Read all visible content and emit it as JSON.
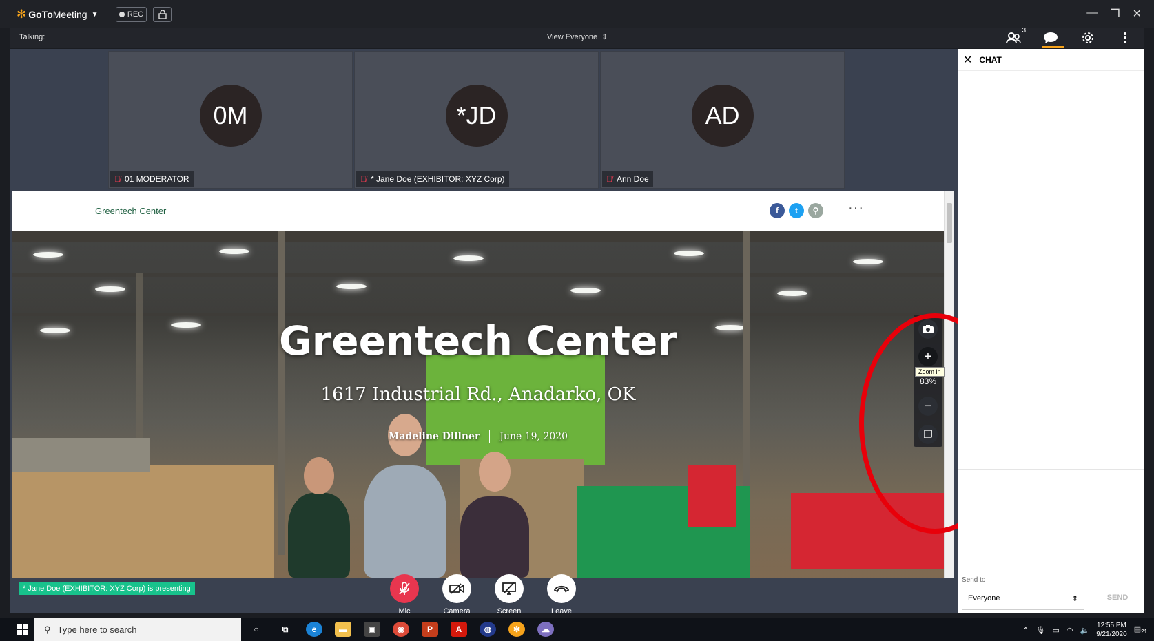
{
  "app": {
    "logo_bold": "GoTo",
    "logo_rest": "Meeting",
    "rec_label": "REC"
  },
  "meetbar": {
    "talking_label": "Talking:",
    "view_label": "View Everyone",
    "participants_count": "3"
  },
  "participants": [
    {
      "initials": "0M",
      "name": "01 MODERATOR"
    },
    {
      "initials": "*JD",
      "name": "* Jane Doe (EXHIBITOR: XYZ Corp)"
    },
    {
      "initials": "AD",
      "name": "Ann Doe"
    }
  ],
  "shared": {
    "brand": "Greentech Center",
    "more": "···",
    "title": "Greentech Center",
    "address": "1617 Industrial Rd., Anadarko, OK",
    "author": "Madeline Dillner",
    "date": "June 19, 2020"
  },
  "zoom": {
    "percent": "83%",
    "tooltip": "Zoom in"
  },
  "controls": {
    "presenting": "* Jane Doe (EXHIBITOR: XYZ Corp) is presenting",
    "mic": "Mic",
    "camera": "Camera",
    "screen": "Screen",
    "leave": "Leave"
  },
  "chat": {
    "title": "CHAT",
    "send_to_label": "Send to",
    "send_to_value": "Everyone",
    "send_button": "SEND"
  },
  "taskbar": {
    "search_placeholder": "Type here to search",
    "time": "12:55 PM",
    "date": "9/21/2020",
    "notif_count": "21"
  },
  "colors": {
    "accent": "#f6a31b",
    "mic_red": "#e8364f",
    "presenting_green": "#18c28c",
    "annotation_red": "#e8000a"
  }
}
